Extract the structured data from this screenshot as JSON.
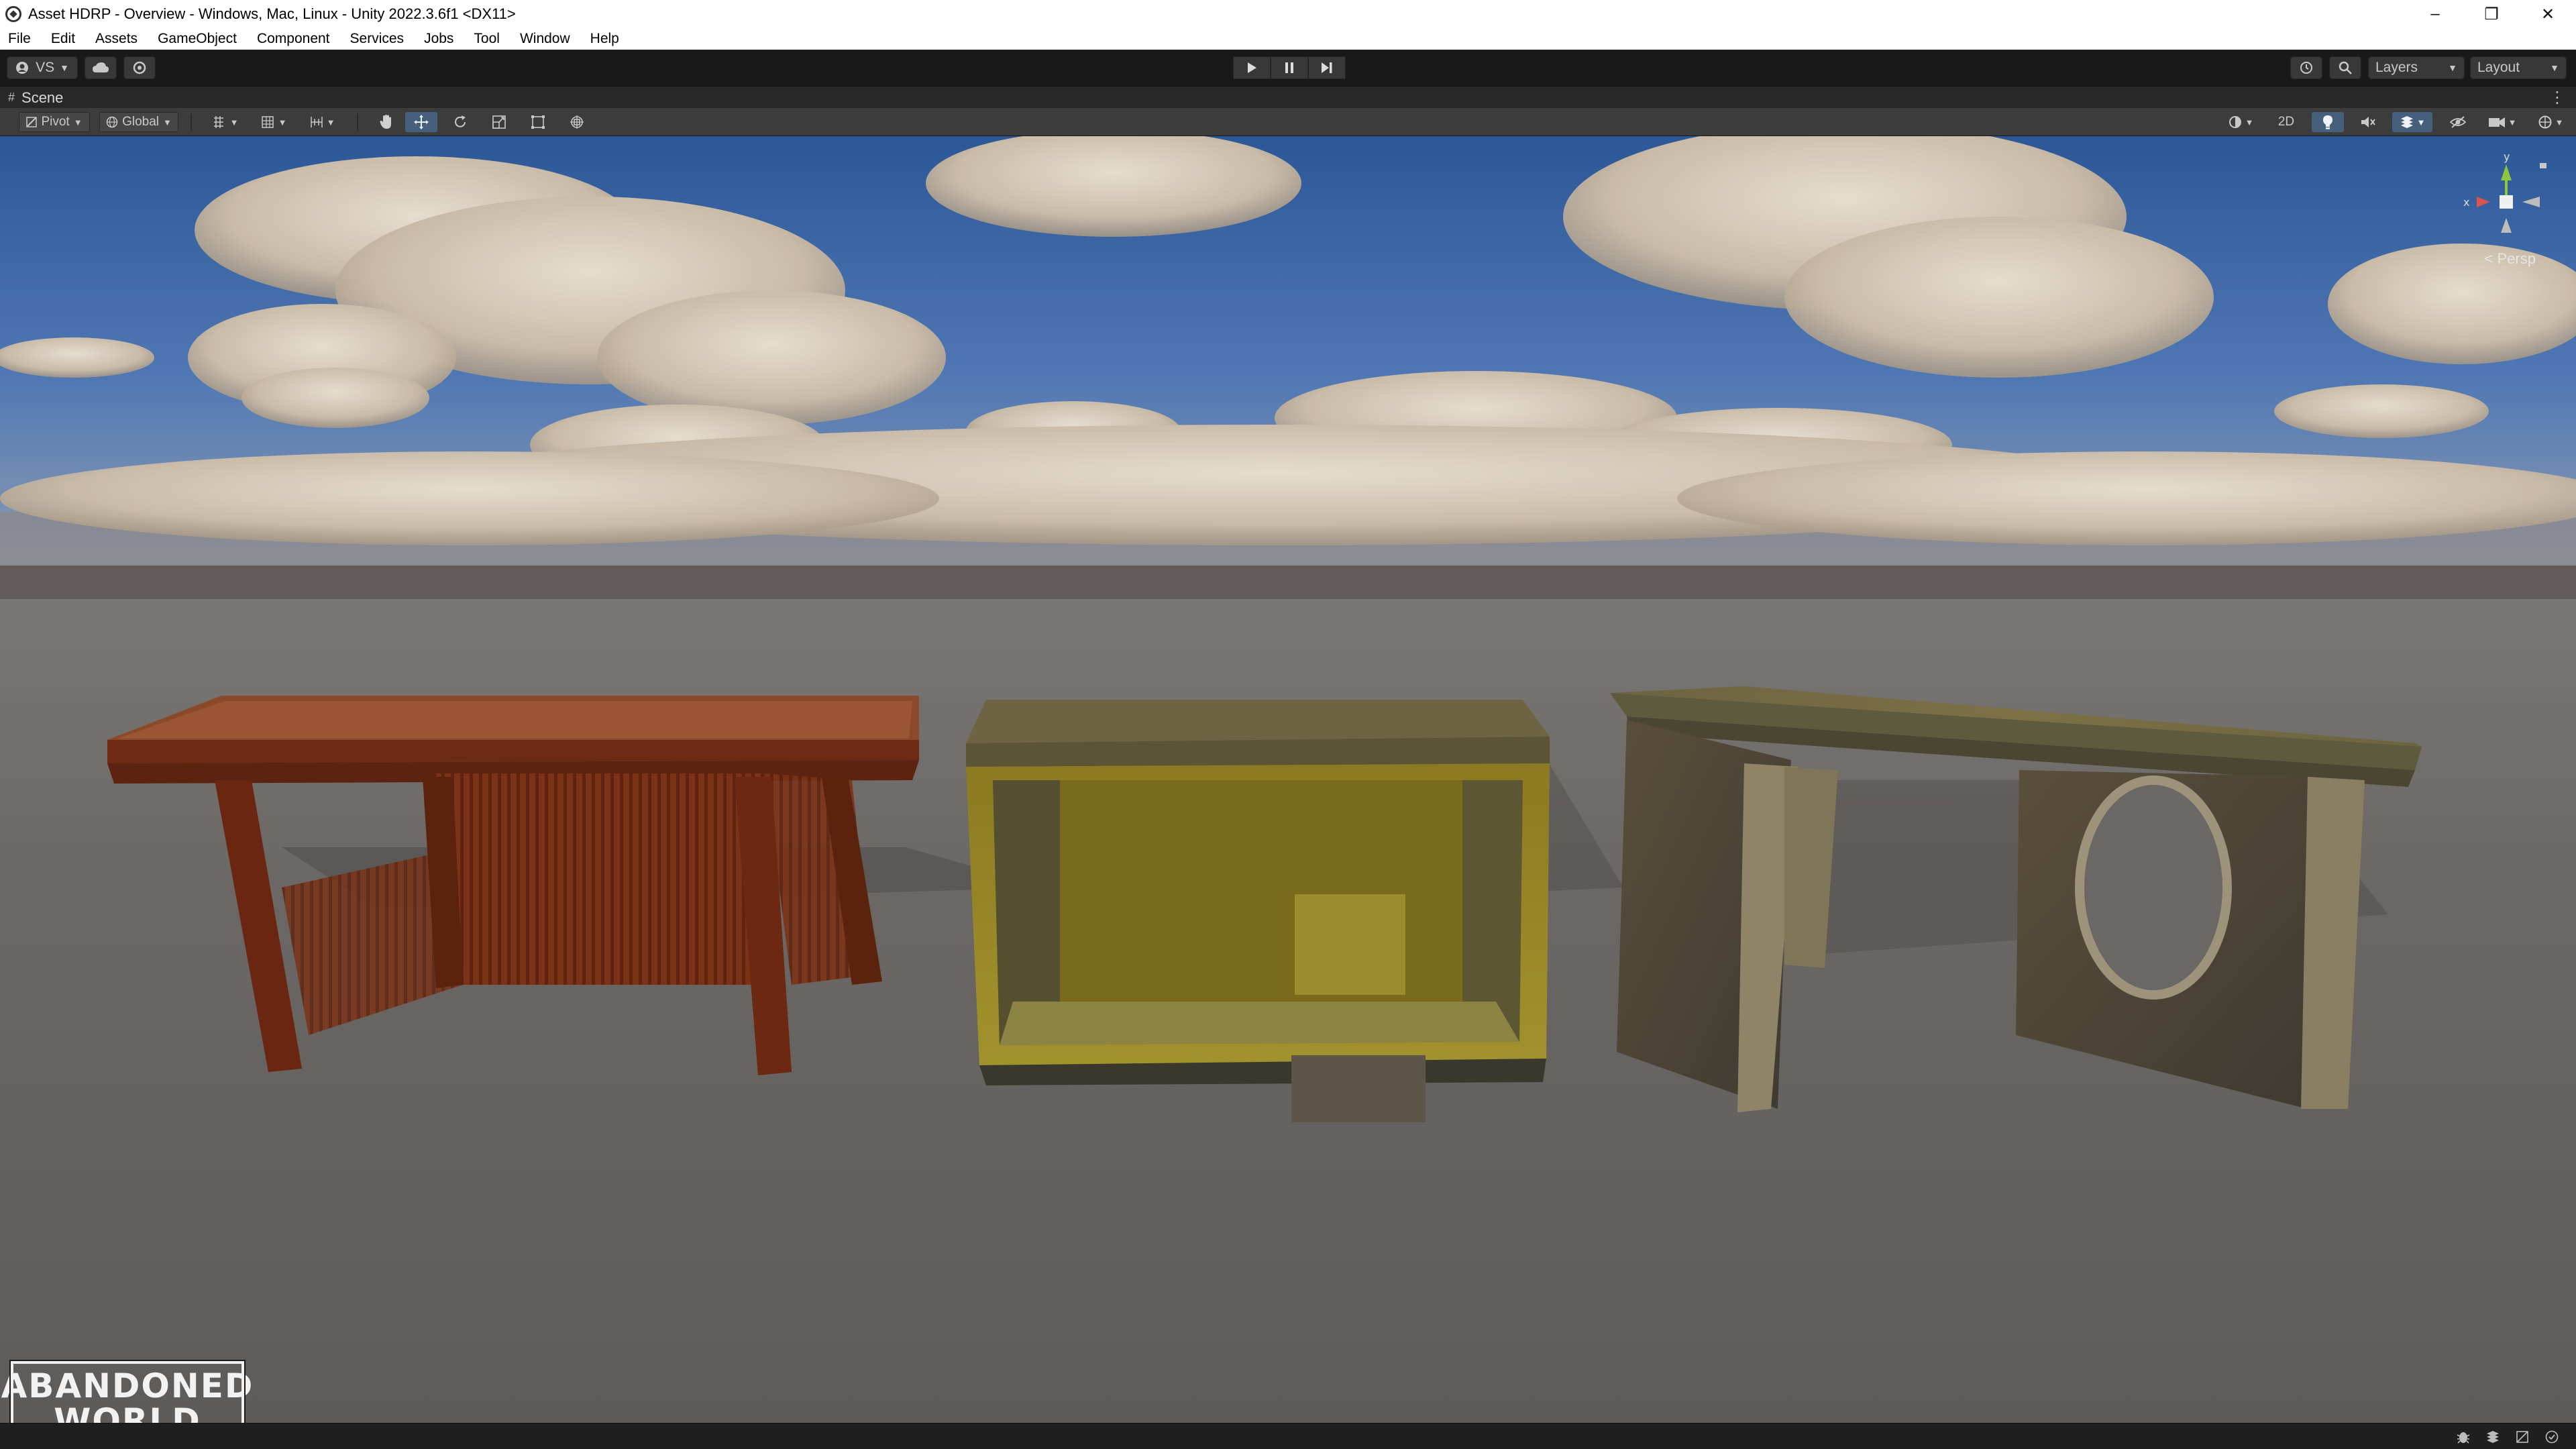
{
  "window": {
    "title": "Asset HDRP - Overview - Windows, Mac, Linux - Unity 2022.3.6f1 <DX11>",
    "controls": [
      "–",
      "❐",
      "✕"
    ]
  },
  "menu": {
    "items": [
      "File",
      "Edit",
      "Assets",
      "GameObject",
      "Component",
      "Services",
      "Jobs",
      "Tool",
      "Window",
      "Help"
    ]
  },
  "toolbar": {
    "account_label": "VS",
    "layers_label": "Layers",
    "layout_label": "Layout"
  },
  "scene": {
    "tab_label": "Scene",
    "pivot_label": "Pivot",
    "global_label": "Global",
    "mode_2d_label": "2D",
    "persp_label": "Persp",
    "gizmo_axes": {
      "x": "x",
      "y": "y"
    }
  },
  "logo": {
    "line1": "ABANDONED",
    "line2": "WORLD"
  },
  "colors": {
    "accent_active": "#46607c",
    "sky_top": "#2f5b9a",
    "ground": "#6e6b69",
    "x_axis": "#d9534f",
    "y_axis": "#8cc63f"
  },
  "icons": [
    "account-icon",
    "cloud-icon",
    "collab-icon",
    "play-icon",
    "pause-icon",
    "step-icon",
    "history-icon",
    "search-icon",
    "hand-tool-icon",
    "move-tool-icon",
    "rotate-tool-icon",
    "scale-tool-icon",
    "rect-tool-icon",
    "transform-tool-icon",
    "shading-mode-icon",
    "lighting-icon",
    "audio-icon",
    "effects-icon",
    "visibility-icon",
    "camera-icon",
    "gizmos-icon"
  ]
}
